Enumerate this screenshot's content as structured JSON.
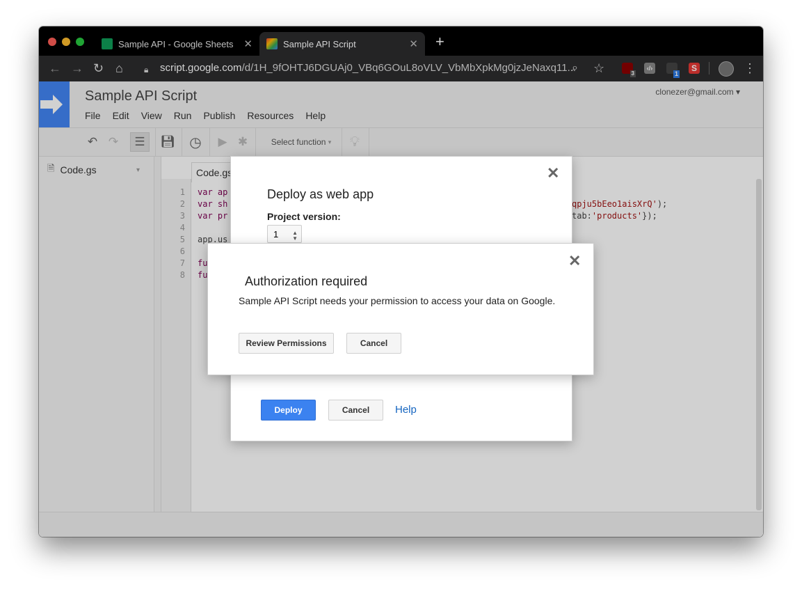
{
  "browser": {
    "tabs": [
      {
        "label": "Sample API - Google Sheets",
        "close": "✕",
        "favicon_color": "#0f9d58",
        "favicon_icon": "sheets-favicon-icon"
      },
      {
        "label": "Sample API Script",
        "close": "✕",
        "favicon_color": "#ea4335",
        "favicon_icon": "apps-script-favicon-icon"
      }
    ],
    "new_tab": "+",
    "url_host": "script.google.com",
    "url_path": "/d/1H_9fOHTJ6DGUAj0_VBq6GOuL8oVLV_VbMbXpkMg0jzJeNaxq11...",
    "extensions": [
      {
        "icon": "ublock-icon",
        "badge": "3",
        "color": "#8b0000"
      },
      {
        "icon": "code-icon",
        "color": "#888888"
      },
      {
        "icon": "screencast-icon",
        "badge": "1",
        "color": "#2c7be5"
      },
      {
        "icon": "s-extension-icon",
        "label": "S",
        "color": "#e53935"
      }
    ]
  },
  "app": {
    "title": "Sample API Script",
    "menu": [
      "File",
      "Edit",
      "View",
      "Run",
      "Publish",
      "Resources",
      "Help"
    ],
    "account": "clonezer@gmail.com",
    "toolbar": {
      "select_function": "Select function"
    },
    "sidebar": {
      "file": "Code.gs"
    },
    "editor": {
      "tab": "Code.gs",
      "lines": [
        {
          "num": "1",
          "left": "var ap",
          "right": ""
        },
        {
          "num": "2",
          "left": "var sh",
          "right_str": "qpju5bEeo1aisXrQ'",
          "right_tail": ");"
        },
        {
          "num": "3",
          "left": "var pr",
          "right_pre": "tab:",
          "right_str": "'products'",
          "right_tail": "});"
        },
        {
          "num": "4",
          "left": "",
          "right": ""
        },
        {
          "num": "5",
          "left": "app.us",
          "right": ""
        },
        {
          "num": "6",
          "left": "",
          "right": ""
        },
        {
          "num": "7",
          "left": "fu",
          "right": ""
        },
        {
          "num": "8",
          "left": "fu",
          "right": ""
        }
      ]
    }
  },
  "deploy_dialog": {
    "title": "Deploy as web app",
    "project_version_label": "Project version:",
    "version_value": "1",
    "close": "✕",
    "deploy_button": "Deploy",
    "cancel_button": "Cancel",
    "help_link": "Help"
  },
  "auth_dialog": {
    "title": "Authorization required",
    "message": "Sample API Script needs your permission to access your data on Google.",
    "close": "✕",
    "review_button": "Review Permissions",
    "cancel_button": "Cancel"
  }
}
